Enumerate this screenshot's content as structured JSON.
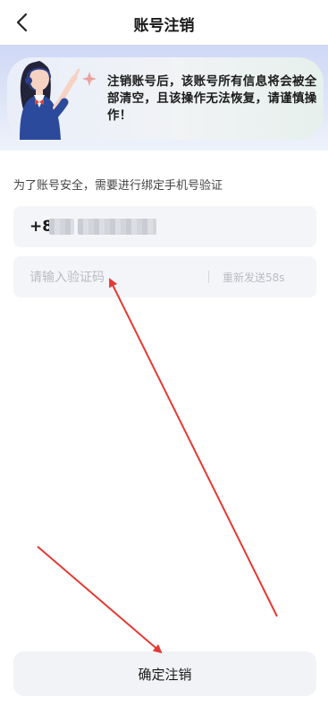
{
  "header": {
    "title": "账号注销"
  },
  "banner": {
    "warning": "注销账号后，该账号所有信息将会被全部清空，且该操作无法恢复，请谨慎操作！"
  },
  "form": {
    "tip": "为了账号安全，需要进行绑定手机号验证",
    "phone_prefix": "+8",
    "code_placeholder": "请输入验证码",
    "resend": "重新发送58s"
  },
  "footer": {
    "confirm_label": "确定注销"
  },
  "colors": {
    "annotation_arrow": "#e53935",
    "banner_bg": "#dfe6f8"
  }
}
